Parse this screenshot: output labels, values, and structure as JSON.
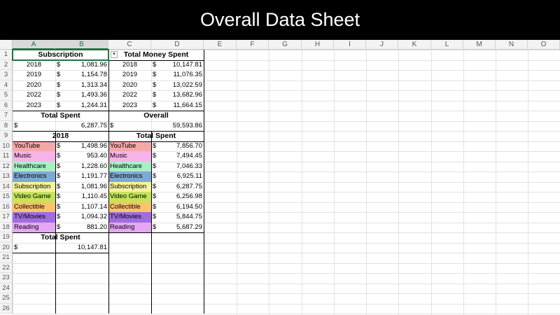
{
  "title": "Overall Data Sheet",
  "columns": [
    "A",
    "B",
    "C",
    "D",
    "E",
    "F",
    "G",
    "H",
    "I",
    "J",
    "K",
    "L",
    "M",
    "N",
    "O"
  ],
  "rows": [
    "1",
    "2",
    "3",
    "4",
    "5",
    "6",
    "7",
    "8",
    "9",
    "10",
    "11",
    "12",
    "13",
    "14",
    "15",
    "16",
    "17",
    "18",
    "19",
    "20",
    "21",
    "22",
    "23",
    "24",
    "25",
    "26"
  ],
  "dropdown_glyph": "▾",
  "subscription": {
    "header": "Subscription",
    "years": [
      {
        "year": "2018",
        "cur": "$",
        "amt": "1,081.96"
      },
      {
        "year": "2019",
        "cur": "$",
        "amt": "1,154.78"
      },
      {
        "year": "2020",
        "cur": "$",
        "amt": "1,313.34"
      },
      {
        "year": "2022",
        "cur": "$",
        "amt": "1,493.36"
      },
      {
        "year": "2023",
        "cur": "$",
        "amt": "1,244.31"
      }
    ],
    "total_label": "Total Spent",
    "total_cur": "$",
    "total_amt": "6,287.75"
  },
  "money_spent": {
    "header": "Total Money Spent",
    "years": [
      {
        "year": "2018",
        "cur": "$",
        "amt": "10,147.81"
      },
      {
        "year": "2019",
        "cur": "$",
        "amt": "11,076.35"
      },
      {
        "year": "2020",
        "cur": "$",
        "amt": "13,022.59"
      },
      {
        "year": "2022",
        "cur": "$",
        "amt": "13,682.96"
      },
      {
        "year": "2023",
        "cur": "$",
        "amt": "11,664.15"
      }
    ],
    "overall_label": "Overall",
    "overall_cur": "$",
    "overall_amt": "59,593.86"
  },
  "categories_2018": {
    "header": "2018",
    "items": [
      {
        "name": "YouTube",
        "cur": "$",
        "amt": "1,498.96",
        "color": "#f4a9a8"
      },
      {
        "name": "Music",
        "cur": "$",
        "amt": "953.40",
        "color": "#f7b3e8"
      },
      {
        "name": "Healthcare",
        "cur": "$",
        "amt": "1,228.60",
        "color": "#a9efc4"
      },
      {
        "name": "Electronics",
        "cur": "$",
        "amt": "1,191.77",
        "color": "#7fa9d4"
      },
      {
        "name": "Subscription",
        "cur": "$",
        "amt": "1,081.96",
        "color": "#f6f39a"
      },
      {
        "name": "Video Game",
        "cur": "$",
        "amt": "1,110.45",
        "color": "#c6e35a"
      },
      {
        "name": "Collectible",
        "cur": "$",
        "amt": "1,107.14",
        "color": "#f9c46a"
      },
      {
        "name": "TV/Movies",
        "cur": "$",
        "amt": "1,094.32",
        "color": "#9f6de0"
      },
      {
        "name": "Reading",
        "cur": "$",
        "amt": "881.20",
        "color": "#e5a6f4"
      }
    ],
    "total_label": "Total Spent",
    "total_cur": "$",
    "total_amt": "10,147.81"
  },
  "categories_total": {
    "header": "Total Spent",
    "items": [
      {
        "name": "YouTube",
        "cur": "$",
        "amt": "7,856.70",
        "color": "#f4a9a8"
      },
      {
        "name": "Music",
        "cur": "$",
        "amt": "7,494.45",
        "color": "#f7b3e8"
      },
      {
        "name": "Healthcare",
        "cur": "$",
        "amt": "7,046.33",
        "color": "#a9efc4"
      },
      {
        "name": "Electronics",
        "cur": "$",
        "amt": "6,925.11",
        "color": "#7fa9d4"
      },
      {
        "name": "Subscription",
        "cur": "$",
        "amt": "6,287.75",
        "color": "#f6f39a"
      },
      {
        "name": "Video Game",
        "cur": "$",
        "amt": "6,256.98",
        "color": "#c6e35a"
      },
      {
        "name": "Collectible",
        "cur": "$",
        "amt": "6,194.50",
        "color": "#f9c46a"
      },
      {
        "name": "TV/Movies",
        "cur": "$",
        "amt": "5,844.75",
        "color": "#9f6de0"
      },
      {
        "name": "Reading",
        "cur": "$",
        "amt": "5,687.29",
        "color": "#e5a6f4"
      }
    ]
  }
}
